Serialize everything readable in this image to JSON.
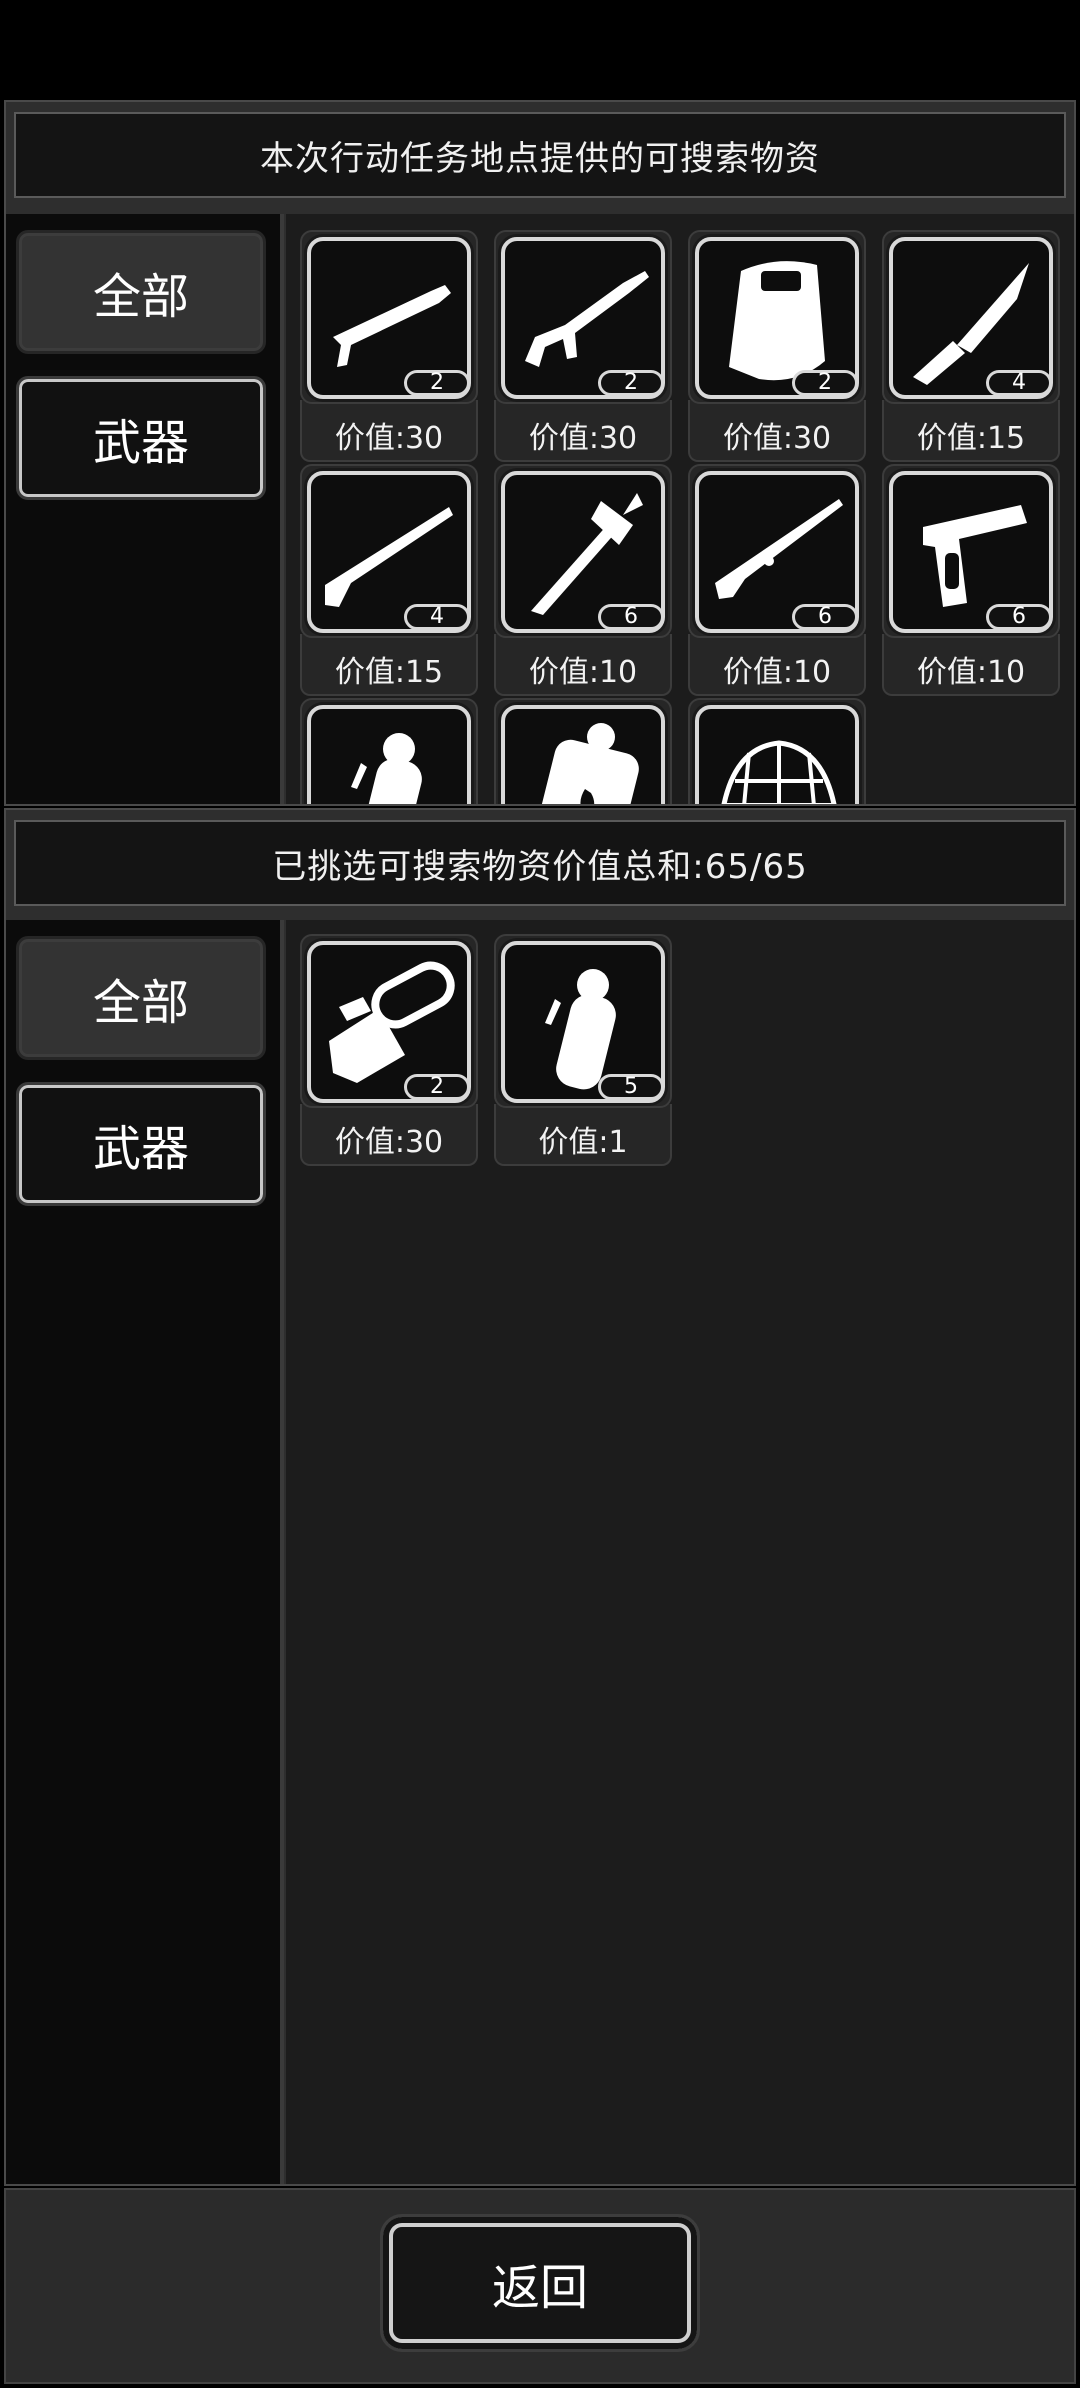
{
  "top_panel": {
    "title": "本次行动任务地点提供的可搜索物资",
    "tabs": [
      {
        "label": "全部",
        "active": true
      },
      {
        "label": "武器",
        "active": false
      }
    ],
    "items": [
      {
        "icon": "shotgun-icon",
        "count": "2",
        "value": "价值:30"
      },
      {
        "icon": "assault-rifle-icon",
        "count": "2",
        "value": "价值:30"
      },
      {
        "icon": "riot-shield-icon",
        "count": "2",
        "value": "价值:30"
      },
      {
        "icon": "combat-knife-icon",
        "count": "4",
        "value": "价值:15"
      },
      {
        "icon": "sawed-off-shotgun-icon",
        "count": "4",
        "value": "价值:15"
      },
      {
        "icon": "fire-axe-icon",
        "count": "6",
        "value": "价值:10"
      },
      {
        "icon": "bolt-action-rifle-icon",
        "count": "6",
        "value": "价值:10"
      },
      {
        "icon": "pistol-icon",
        "count": "6",
        "value": "价值:10"
      },
      {
        "icon": "stun-grenade-icon",
        "count": "",
        "value": ""
      },
      {
        "icon": "fire-grenade-icon",
        "count": "",
        "value": ""
      },
      {
        "icon": "camo-helmet-icon",
        "count": "",
        "value": ""
      }
    ]
  },
  "bottom_panel": {
    "title": "已挑选可搜索物资价值总和:65/65",
    "tabs": [
      {
        "label": "全部",
        "active": true
      },
      {
        "label": "武器",
        "active": false
      }
    ],
    "items": [
      {
        "icon": "chainsaw-icon",
        "count": "2",
        "value": "价值:30"
      },
      {
        "icon": "stun-grenade-icon",
        "count": "5",
        "value": "价值:1"
      }
    ]
  },
  "footer": {
    "back_label": "返回"
  }
}
